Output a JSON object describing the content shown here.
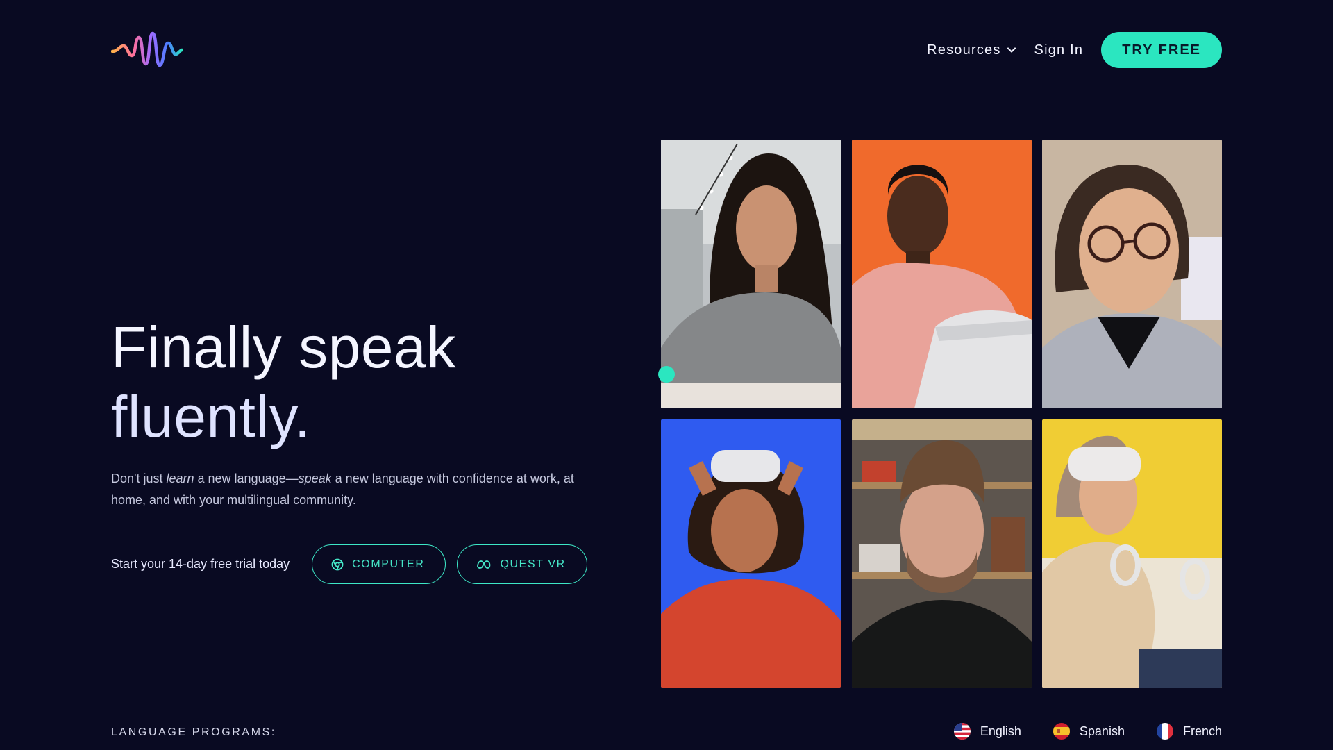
{
  "header": {
    "nav": {
      "resources_label": "Resources",
      "sign_in_label": "Sign In",
      "try_free_label": "TRY FREE"
    }
  },
  "hero": {
    "title_line1": "Finally speak",
    "title_line2": "fluently.",
    "desc_part1": "Don't just ",
    "desc_em1": "learn",
    "desc_part2": " a new language—",
    "desc_em2": "speak",
    "desc_part3": " a new language with confidence at work, at home, and with your multilingual community.",
    "trial_text": "Start your 14-day free trial today",
    "computer_button": "COMPUTER",
    "quest_vr_button": "QUEST VR"
  },
  "footer": {
    "programs_label": "LANGUAGE PROGRAMS:",
    "languages": [
      "English",
      "Spanish",
      "French"
    ]
  },
  "colors": {
    "background": "#090a22",
    "accent": "#2be6c0"
  },
  "icons": [
    "logo-wave-icon",
    "chevron-down-icon",
    "chrome-icon",
    "meta-icon",
    "us-flag-icon",
    "spain-flag-icon",
    "france-flag-icon"
  ]
}
